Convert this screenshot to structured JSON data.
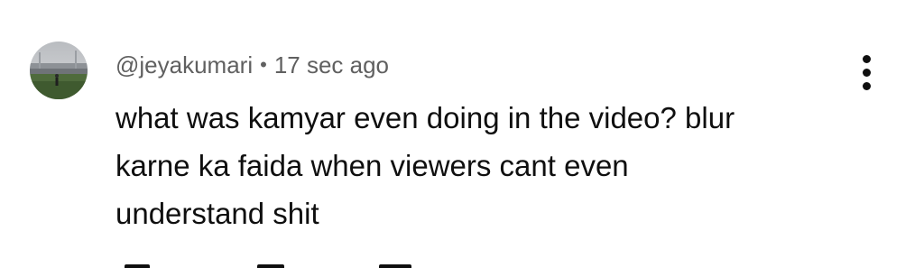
{
  "comment": {
    "author": "@jeyakumari",
    "separator": "•",
    "timestamp": "17 sec ago",
    "text_lines": [
      "what was kamyar even doing in the video? blur",
      "karne ka faida when viewers cant even",
      "understand shit"
    ],
    "avatar_icon": "user-avatar-stadium-photo",
    "more_icon": "more-vertical-icon"
  },
  "actions": {
    "like_icon": "thumbs-up-icon",
    "dislike_icon": "thumbs-down-icon",
    "reply_icon": "reply-icon"
  },
  "colors": {
    "text_primary": "#0f0f0f",
    "text_secondary": "#606060",
    "background": "#ffffff"
  }
}
